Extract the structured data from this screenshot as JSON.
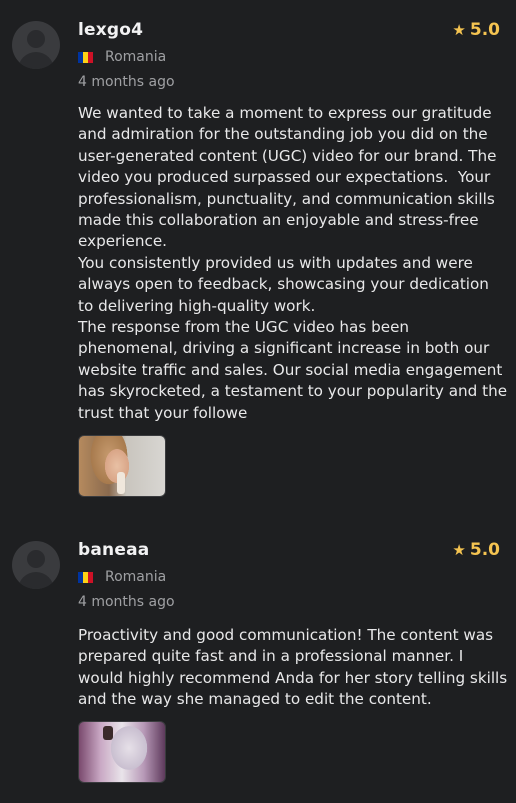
{
  "reviews": [
    {
      "username": "lexgo4",
      "rating": "5.0",
      "country": "Romania",
      "time_ago": "4 months ago",
      "text": "We wanted to take a moment to express our gratitude and admiration for the outstanding job you did on the user-generated content (UGC) video for our brand. The video you produced surpassed our expectations.  Your professionalism, punctuality, and communication skills made this collaboration an enjoyable and stress-free experience.\nYou consistently provided us with updates and were always open to feedback, showcasing your dedication to delivering high-quality work.\nThe response from the UGC video has been phenomenal, driving a significant increase in both our website traffic and sales. Our social media engagement has skyrocketed, a testament to your popularity and the trust that your followe",
      "icons": {
        "avatar": "user-avatar-placeholder",
        "rating": "star-icon",
        "flag": "romania-flag-icon"
      }
    },
    {
      "username": "baneaa",
      "rating": "5.0",
      "country": "Romania",
      "time_ago": "4 months ago",
      "text": "Proactivity and good communication! The content was prepared quite fast and in a professional manner. I would highly recommend Anda for her story telling skills and the way she managed to edit the content.",
      "icons": {
        "avatar": "user-avatar-placeholder",
        "rating": "star-icon",
        "flag": "romania-flag-icon"
      }
    }
  ],
  "colors": {
    "background": "#1e1f21",
    "star": "#f5c451",
    "muted_text": "#9fa0a3"
  }
}
